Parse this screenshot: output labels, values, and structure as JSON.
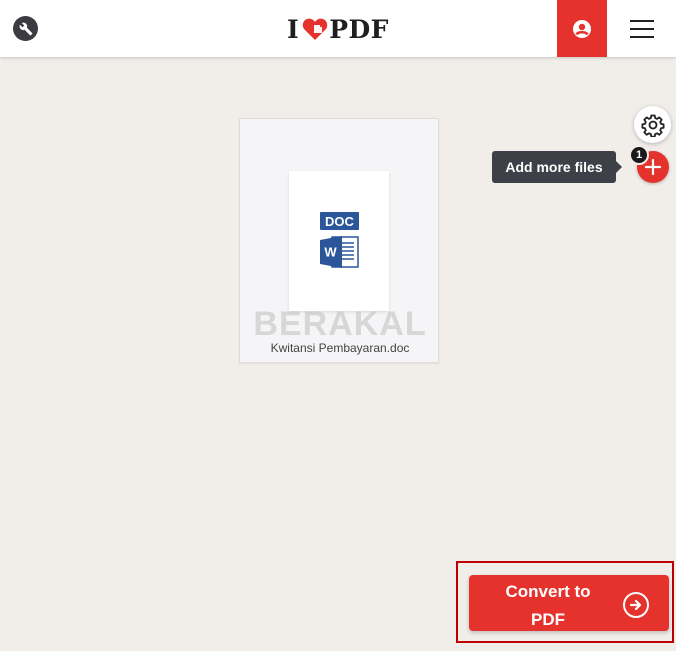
{
  "header": {
    "logo_prefix": "I",
    "logo_suffix": "PDF",
    "tools_icon": "wrench-icon",
    "user_icon": "user-icon",
    "menu_icon": "hamburger-menu-icon"
  },
  "sidebar_actions": {
    "settings_icon": "gear-icon",
    "add_icon": "plus-icon",
    "add_tooltip": "Add more files",
    "file_count": "1"
  },
  "file": {
    "type_label": "DOC",
    "icon": "word-document-icon",
    "name": "Kwitansi Pembayaran.doc",
    "watermark": "BERAKAL"
  },
  "action": {
    "convert_label_line1": "Convert to",
    "convert_label_line2": "PDF",
    "arrow_icon": "arrow-right-circle-icon"
  },
  "colors": {
    "brand_red": "#e5322d",
    "background": "#f1eeea",
    "word_blue": "#2b579a",
    "tooltip_bg": "#3d4147"
  }
}
